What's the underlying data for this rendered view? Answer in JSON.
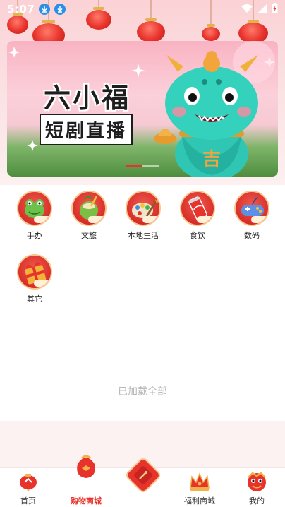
{
  "status_bar": {
    "time": "5:07",
    "icons": [
      "download-icon",
      "download-icon",
      "wifi-icon",
      "signal-icon",
      "battery-charging-icon"
    ]
  },
  "banner": {
    "title": "六小福",
    "subtitle": "短剧直播",
    "slide_count": 2,
    "active_slide": 1
  },
  "categories": [
    {
      "label": "手办",
      "icon": "frog-figure-icon"
    },
    {
      "label": "文旅",
      "icon": "coconut-icon"
    },
    {
      "label": "本地生活",
      "icon": "paint-palette-icon"
    },
    {
      "label": "食饮",
      "icon": "soda-can-icon"
    },
    {
      "label": "数码",
      "icon": "gamepad-icon"
    },
    {
      "label": "其它",
      "icon": "gift-box-icon"
    }
  ],
  "list_footer": "已加载全部",
  "bottom_nav": {
    "items": [
      {
        "label": "首页",
        "icon": "home-lantern-icon",
        "active": false
      },
      {
        "label": "购物商城",
        "icon": "shopping-bag-icon",
        "active": true
      },
      {
        "label": "",
        "icon": "center-red-packet-icon",
        "active": false
      },
      {
        "label": "福利商城",
        "icon": "crown-icon",
        "active": false
      },
      {
        "label": "我的",
        "icon": "lion-mask-icon",
        "active": false
      }
    ]
  },
  "colors": {
    "accent": "#e8332c",
    "gold": "#f8c48a",
    "muted_text": "#b8b8b8"
  }
}
